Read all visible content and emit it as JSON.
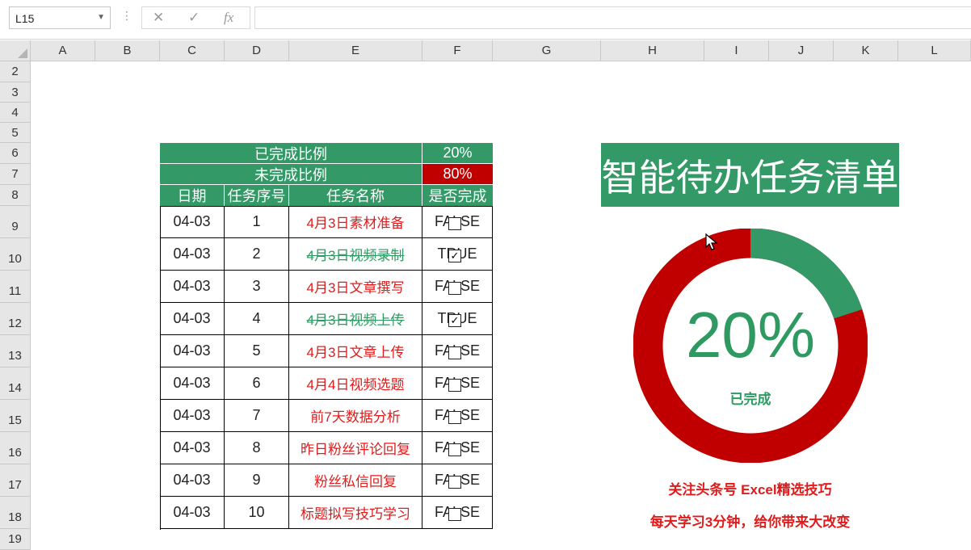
{
  "formula_bar": {
    "name_box": "L15",
    "cancel_icon": "✕",
    "enter_icon": "✓",
    "fx_label": "fx"
  },
  "columns": [
    "A",
    "B",
    "C",
    "D",
    "E",
    "F",
    "G",
    "H",
    "I",
    "J",
    "K",
    "L"
  ],
  "rows": [
    "2",
    "3",
    "4",
    "5",
    "6",
    "7",
    "8",
    "9",
    "10",
    "11",
    "12",
    "13",
    "14",
    "15",
    "16",
    "17",
    "18",
    "19"
  ],
  "summary": {
    "done_label": "已完成比例",
    "done_value": "20%",
    "undone_label": "未完成比例",
    "undone_value": "80%"
  },
  "table": {
    "headers": [
      "日期",
      "任务序号",
      "任务名称",
      "是否完成"
    ],
    "rows": [
      {
        "date": "04-03",
        "no": "1",
        "name": "4月3日素材准备",
        "status": "FALSE",
        "done": false
      },
      {
        "date": "04-03",
        "no": "2",
        "name": "4月3日视频录制",
        "status": "TRUE",
        "done": true
      },
      {
        "date": "04-03",
        "no": "3",
        "name": "4月3日文章撰写",
        "status": "FALSE",
        "done": false
      },
      {
        "date": "04-03",
        "no": "4",
        "name": "4月3日视频上传",
        "status": "TRUE",
        "done": true
      },
      {
        "date": "04-03",
        "no": "5",
        "name": "4月3日文章上传",
        "status": "FALSE",
        "done": false
      },
      {
        "date": "04-03",
        "no": "6",
        "name": "4月4日视频选题",
        "status": "FALSE",
        "done": false
      },
      {
        "date": "04-03",
        "no": "7",
        "name": "前7天数据分析",
        "status": "FALSE",
        "done": false
      },
      {
        "date": "04-03",
        "no": "8",
        "name": "昨日粉丝评论回复",
        "status": "FALSE",
        "done": false
      },
      {
        "date": "04-03",
        "no": "9",
        "name": "粉丝私信回复",
        "status": "FALSE",
        "done": false
      },
      {
        "date": "04-03",
        "no": "10",
        "name": "标题拟写技巧学习",
        "status": "FALSE",
        "done": false
      }
    ]
  },
  "dashboard": {
    "title": "智能待办任务清单",
    "percent_text": "20%",
    "percent_label": "已完成",
    "completed_fraction": 0.2,
    "promo_line1": "关注头条号 Excel精选技巧",
    "promo_line2": "每天学习3分钟，给你带来大改变"
  },
  "colors": {
    "green": "#339966",
    "red": "#c00000",
    "header_gray": "#e6e6e6"
  }
}
